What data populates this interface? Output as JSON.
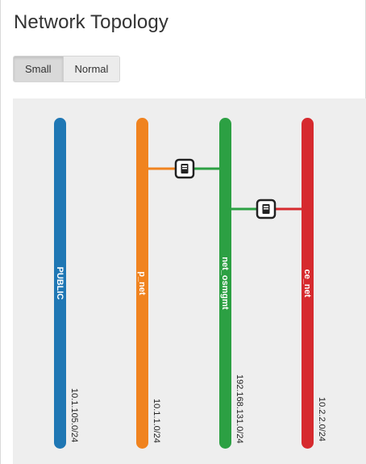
{
  "page": {
    "title": "Network Topology"
  },
  "view_toggle": {
    "options": [
      {
        "label": "Small",
        "active": true
      },
      {
        "label": "Normal",
        "active": false
      }
    ]
  },
  "topology": {
    "networks": [
      {
        "name": "PUBLIC",
        "cidr": "10.1.105.0/24",
        "color": "#1f77b4"
      },
      {
        "name": "p_net",
        "cidr": "10.1.1.0/24",
        "color": "#f0831f"
      },
      {
        "name": "net_osmgmt",
        "cidr": "192.168.131.0/24",
        "color": "#2ca043"
      },
      {
        "name": "ce_net",
        "cidr": "10.2.2.0/24",
        "color": "#d62a2e"
      }
    ],
    "routers": [
      {
        "id": "router-1",
        "icon": "router-icon",
        "connects": [
          "p_net",
          "net_osmgmt"
        ]
      },
      {
        "id": "router-2",
        "icon": "router-icon",
        "connects": [
          "net_osmgmt",
          "ce_net"
        ]
      }
    ]
  }
}
